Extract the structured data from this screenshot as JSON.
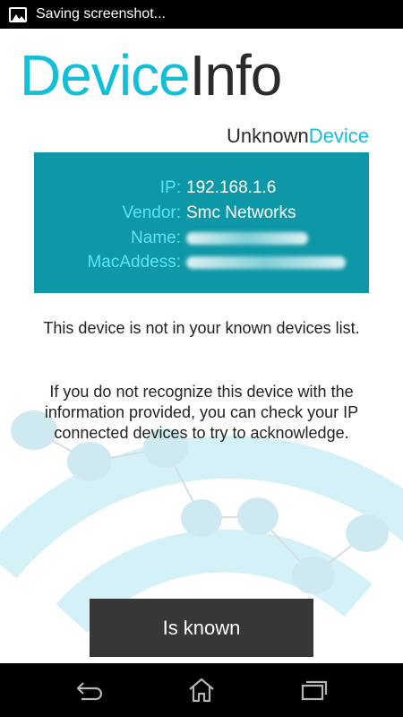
{
  "status_bar": {
    "text": "Saving screenshot..."
  },
  "header": {
    "title_accent": "Device",
    "title_dark": "Info",
    "subtitle_dark": "Unknown",
    "subtitle_accent": "Device"
  },
  "device": {
    "ip_label": "IP:",
    "ip_value": "192.168.1.6",
    "vendor_label": "Vendor:",
    "vendor_value": "Smc Networks",
    "name_label": "Name:",
    "mac_label": "MacAddess:"
  },
  "message": {
    "line1": "This device is not in your known devices list.",
    "line2": "If you do not recognize this device with the information provided, you can check your IP connected devices to try to acknowledge."
  },
  "actions": {
    "known_label": "Is known"
  },
  "nav": {
    "icons": [
      "back-icon",
      "home-icon",
      "recents-icon"
    ]
  },
  "colors": {
    "accent": "#12bfd6",
    "panel": "#0e97a6",
    "panel_label": "#5fe3f3",
    "button": "#373737"
  }
}
